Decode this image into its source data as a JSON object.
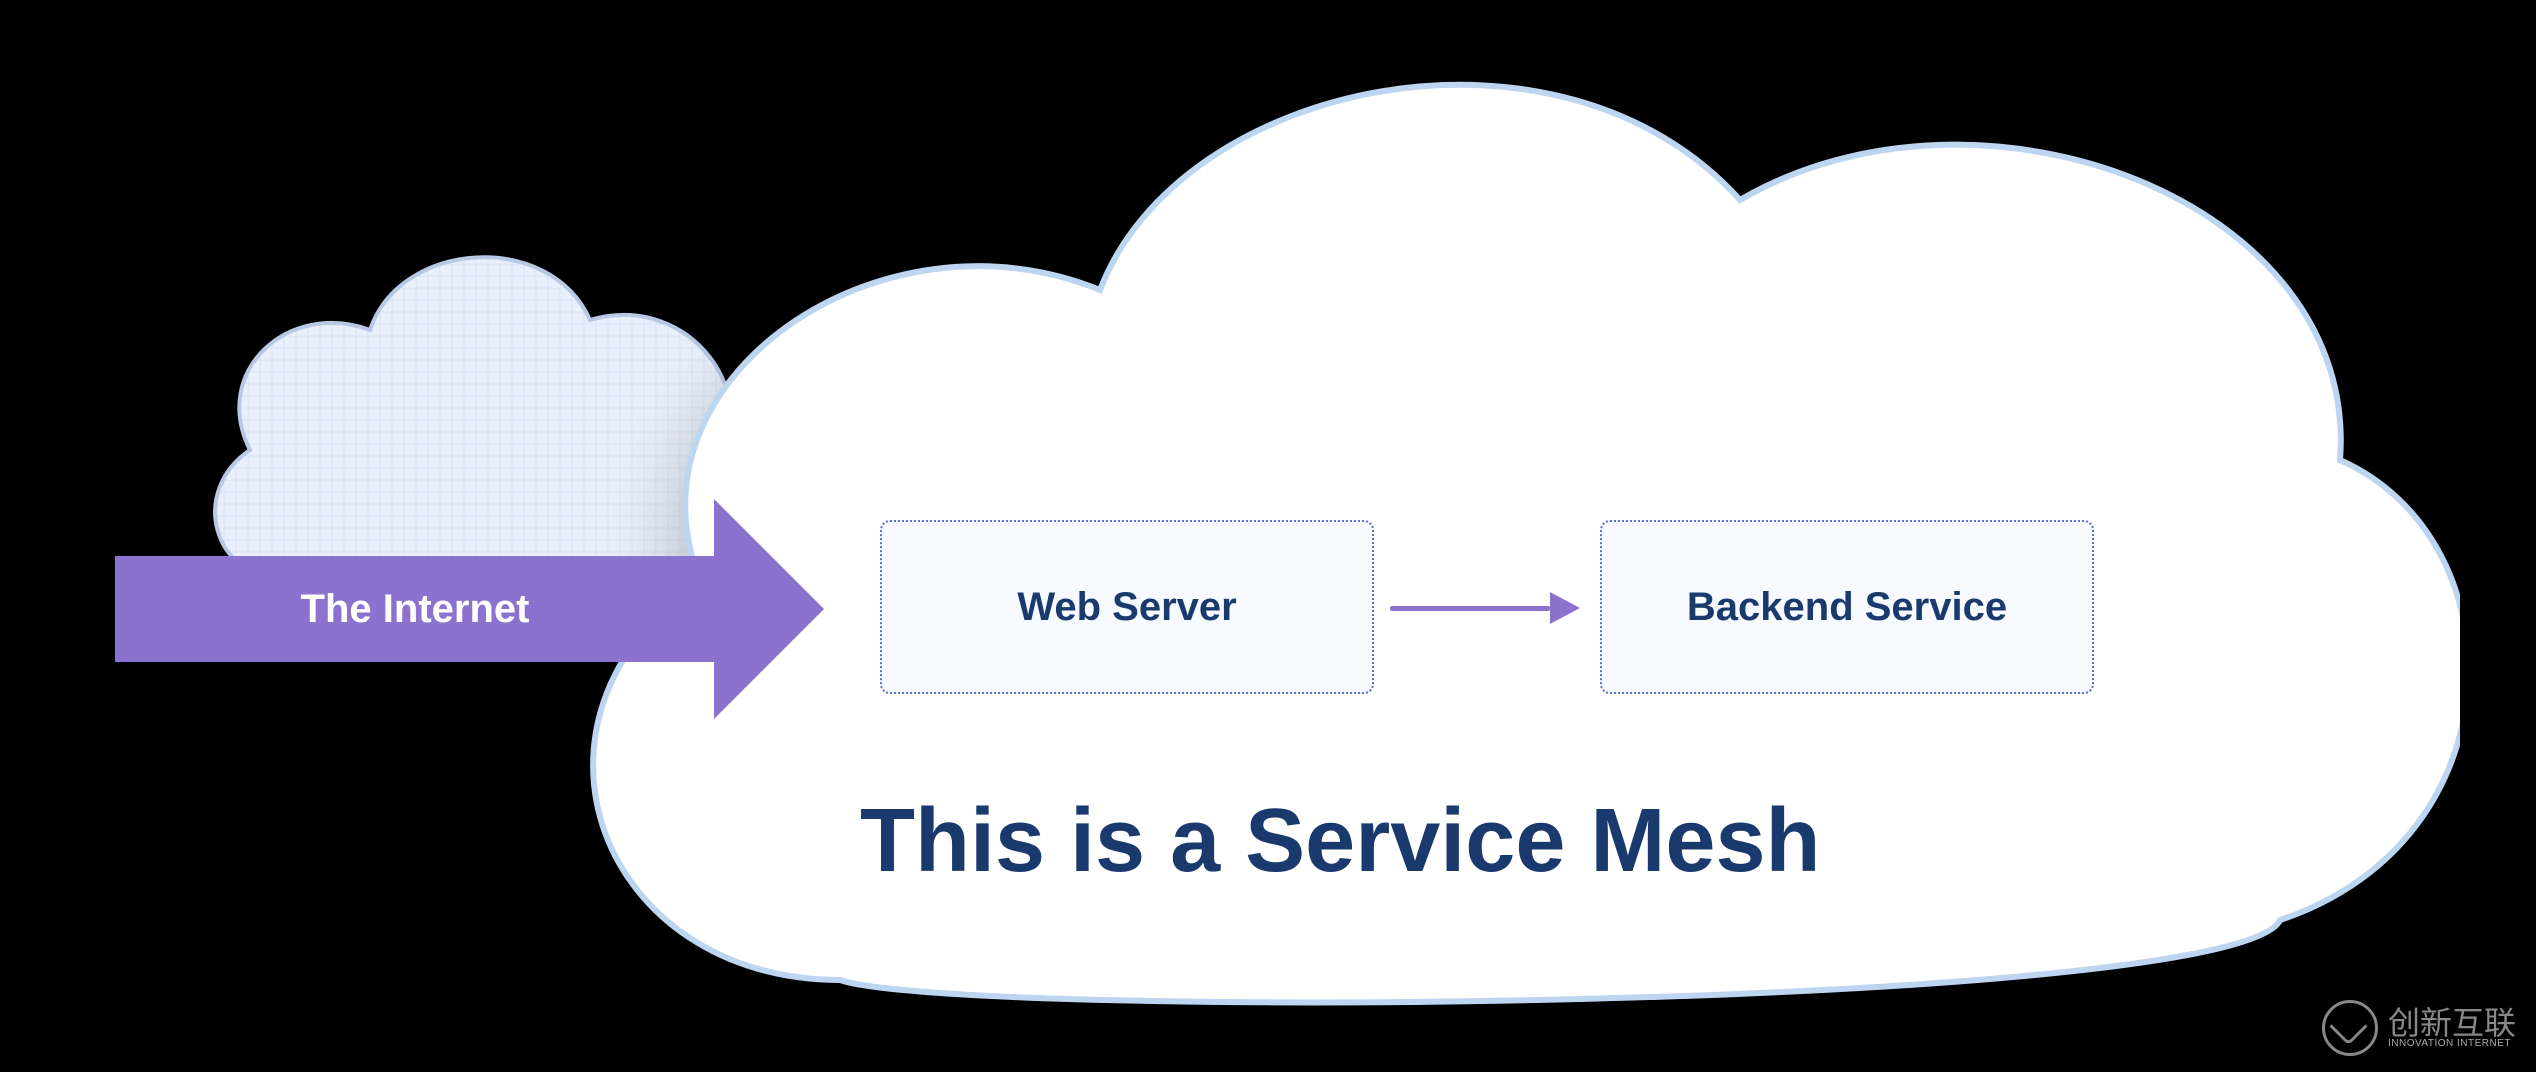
{
  "internet_label": "The Internet",
  "nodes": {
    "web_server": "Web Server",
    "backend_service": "Backend Service"
  },
  "mesh_caption": "This is a Service Mesh",
  "watermark": {
    "brand": "创新互联",
    "tag": "INNOVATION INTERNET"
  },
  "colors": {
    "arrow": "#8c72cf",
    "text_primary": "#1a3a6e",
    "box_border": "#5a6fd6",
    "box_fill": "#f7faff",
    "small_cloud_fill": "#e9f0fb",
    "small_cloud_stroke": "#b8c9e6",
    "large_cloud_fill": "#ffffff",
    "large_cloud_stroke": "#bcd5f0"
  }
}
